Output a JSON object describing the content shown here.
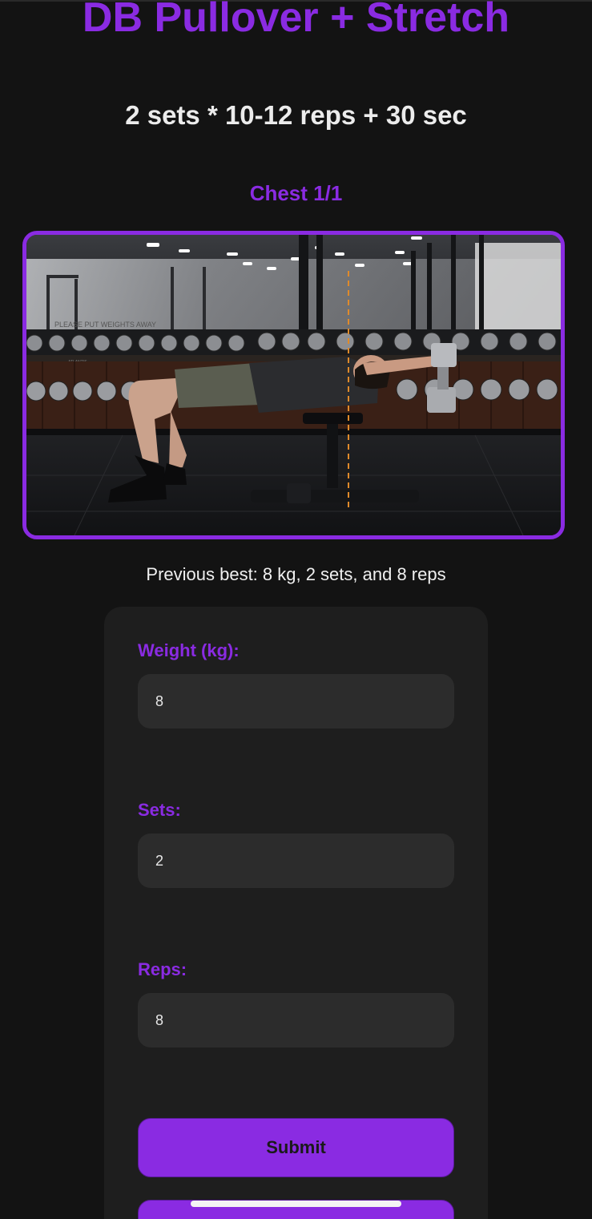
{
  "exercise": {
    "title": "DB Pullover + Stretch",
    "prescription": "2 sets * 10-12 reps + 30 sec",
    "category": "Chest 1/1"
  },
  "demo_image": {
    "description_icon": "exercise-photo-icon",
    "wall_text": "PLEASE PUT WEIGHTS AWAY",
    "rack_text": "ATLANTIS"
  },
  "previous_best": "Previous best: 8 kg, 2 sets, and 8 reps",
  "form": {
    "weight": {
      "label": "Weight (kg):",
      "value": "8"
    },
    "sets": {
      "label": "Sets:",
      "value": "2"
    },
    "reps": {
      "label": "Reps:",
      "value": "8"
    },
    "submit_label": "Submit"
  },
  "colors": {
    "accent": "#8a2be2",
    "background": "#131313",
    "card": "#1e1e1e",
    "input": "#2c2c2c"
  }
}
